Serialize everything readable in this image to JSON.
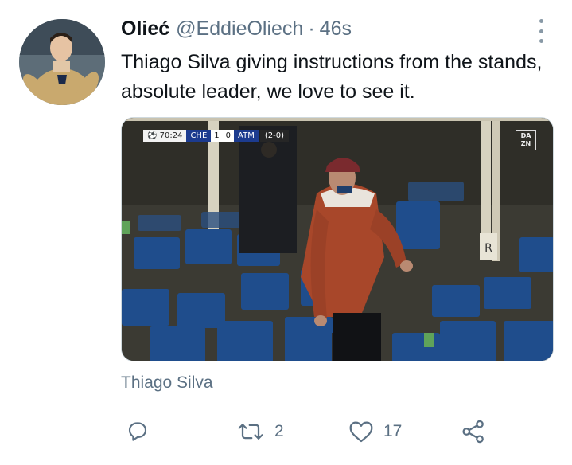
{
  "tweet": {
    "display_name": "Olieć",
    "handle": "@EddieOliech",
    "separator": "·",
    "time": "46s",
    "text": "Thiago Silva giving instructions from the stands, absolute leader, we love to see it.",
    "more_icon": "more-vertical-icon",
    "avatar_icon": "avatar-photo"
  },
  "media": {
    "scoreboard": {
      "time": "⚽ 70:24",
      "home": "CHE",
      "home_score": "1",
      "away_score": "0",
      "away": "ATM",
      "aggregate": "(2-0)"
    },
    "broadcaster_top": "DA",
    "broadcaster_bottom": "ZN",
    "seat_sign": "R",
    "caption": "Thiago Silva"
  },
  "actions": {
    "reply": {
      "icon": "reply-icon",
      "count": ""
    },
    "retweet": {
      "icon": "retweet-icon",
      "count": "2"
    },
    "like": {
      "icon": "heart-icon",
      "count": "17"
    },
    "share": {
      "icon": "share-icon",
      "count": ""
    }
  },
  "colors": {
    "secondary_text": "#5b7083",
    "primary_text": "#0f1419",
    "seat_blue": "#1f4d8c",
    "jacket": "#a8472a"
  }
}
